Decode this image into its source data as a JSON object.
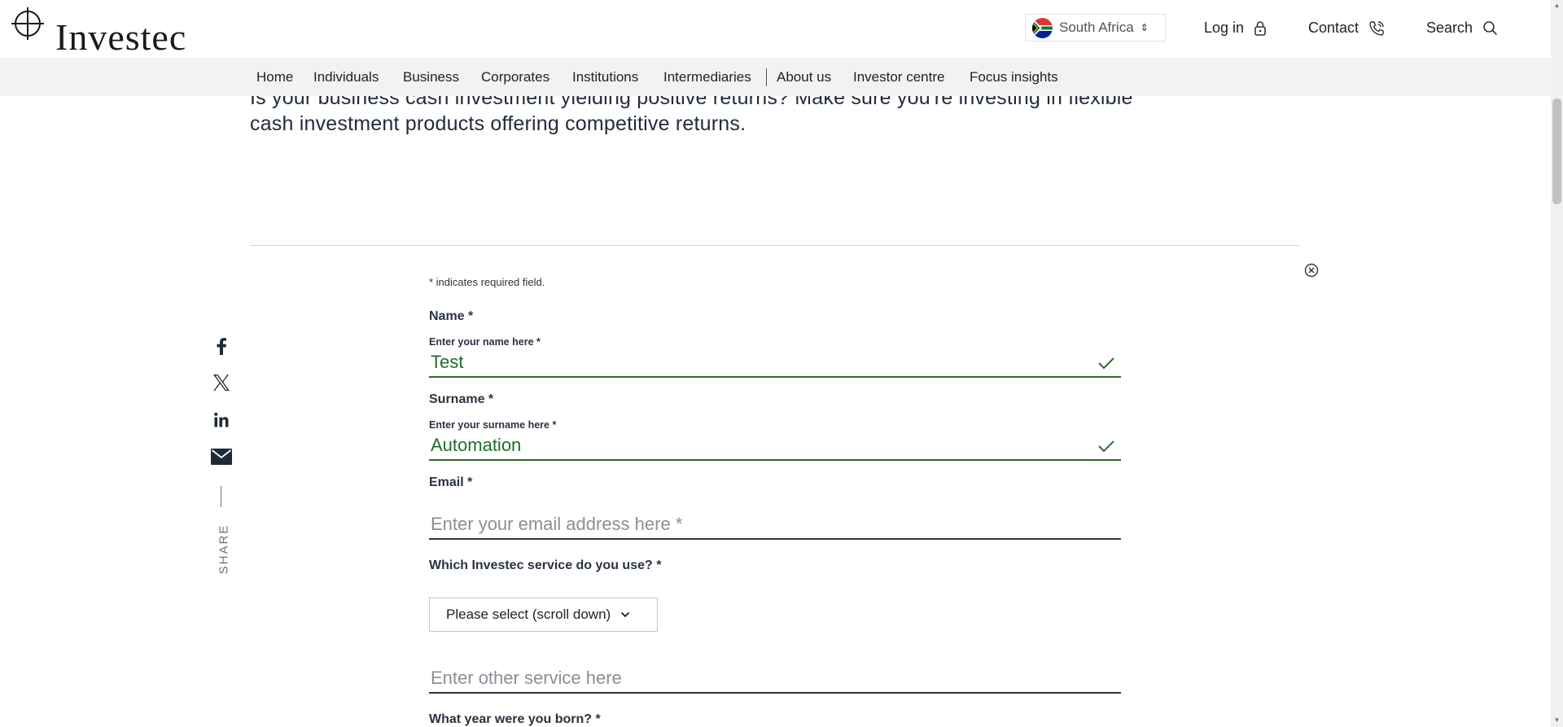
{
  "header": {
    "logo_text": "Investec",
    "country": "South Africa",
    "login": "Log in",
    "contact": "Contact",
    "search": "Search"
  },
  "nav": {
    "items": [
      "Home",
      "Individuals",
      "Business",
      "Corporates",
      "Institutions",
      "Intermediaries",
      "About us",
      "Investor centre",
      "Focus insights"
    ]
  },
  "intro": {
    "text": "Is your business cash investment yielding positive returns? Make sure you're investing in flexible cash investment products offering competitive returns."
  },
  "share": {
    "label": "SHARE",
    "icons": [
      "facebook-icon",
      "x-icon",
      "linkedin-icon",
      "email-icon"
    ]
  },
  "form": {
    "required_note": "* indicates required field.",
    "name_label": "Name *",
    "name_sublabel": "Enter your name here *",
    "name_value": "Test",
    "surname_label": "Surname *",
    "surname_sublabel": "Enter your surname here *",
    "surname_value": "Automation",
    "email_label": "Email *",
    "email_placeholder": "Enter your email address here *",
    "service_label": "Which Investec service do you use? *",
    "service_select": "Please select (scroll down)",
    "other_service_placeholder": "Enter other service here",
    "birth_year_label": "What year were you born? *"
  },
  "colors": {
    "valid_green": "#2e6b2a",
    "nav_bg": "#f2f2f2",
    "text_dark": "#222c3c"
  }
}
